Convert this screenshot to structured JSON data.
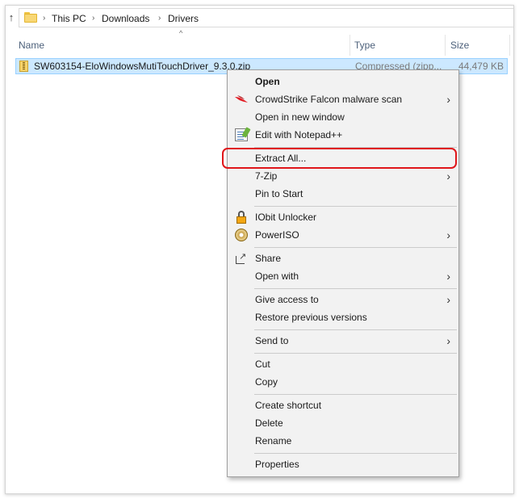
{
  "breadcrumb": {
    "items": [
      "This PC",
      "Downloads",
      "Drivers"
    ],
    "separator": "›"
  },
  "columns": {
    "name": "Name",
    "type": "Type",
    "size": "Size"
  },
  "file": {
    "name": "SW603154-EloWindowsMutiTouchDriver_9.3.0.zip",
    "type": "Compressed (zipp...",
    "size": "44,479 KB"
  },
  "icons": {
    "up": "up-arrow-icon",
    "folder": "folder-icon",
    "zip": "zip-file-icon",
    "falcon": "crowdstrike-falcon-icon",
    "notepad": "notepad-plus-plus-icon",
    "iobit": "iobit-unlocker-lock-icon",
    "poweriso": "poweriso-disc-icon",
    "share": "share-icon",
    "submenu": "chevron-right-icon"
  },
  "colors": {
    "highlight": "#e0161a",
    "selection": "#cce8ff",
    "accent": "#0078d7"
  },
  "menu": {
    "open": "Open",
    "crowdstrike": "CrowdStrike Falcon malware scan",
    "open_new_window": "Open in new window",
    "edit_notepad": "Edit with Notepad++",
    "extract_all": "Extract All...",
    "seven_zip": "7-Zip",
    "pin_to_start": "Pin to Start",
    "iobit_unlocker": "IObit Unlocker",
    "poweriso": "PowerISO",
    "share": "Share",
    "open_with": "Open with",
    "give_access": "Give access to",
    "restore_versions": "Restore previous versions",
    "send_to": "Send to",
    "cut": "Cut",
    "copy": "Copy",
    "create_shortcut": "Create shortcut",
    "delete": "Delete",
    "rename": "Rename",
    "properties": "Properties",
    "submenu_arrow": "›",
    "sort_caret": "^",
    "up_arrow": "↑",
    "share_arrow": "↗"
  }
}
